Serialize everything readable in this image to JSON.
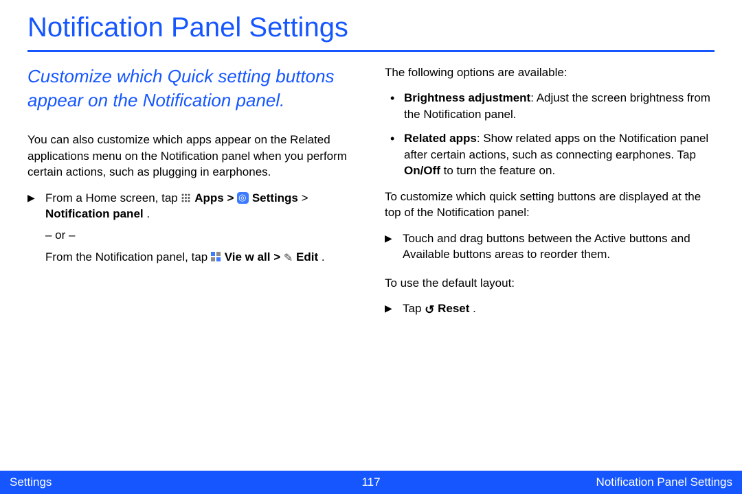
{
  "title": "Notification Panel Settings",
  "lead": "Customize which Quick setting buttons appear on the Notification panel.",
  "left": {
    "intro": "You can also customize which apps appear on the Related applications menu on the Notification panel when you perform certain actions, such as plugging in earphones.",
    "step1_a": "From a Home screen, tap ",
    "apps": "Apps",
    "gt1": " > ",
    "settings": "Settings",
    "gt2": " > ",
    "notif_panel": "Notification panel",
    "dot": ".",
    "or": "– or –",
    "step1_b": "From the Notification panel, tap ",
    "viewall": "Vie w all",
    "gt3": " > ",
    "edit": "Edit",
    "dot2": "."
  },
  "right": {
    "intro": "The following options are available:",
    "b1_label": "Brightness adjustment",
    "b1_body": ": Adjust the screen brightness from the Notification panel.",
    "b2_label": "Related apps",
    "b2_body_a": ": Show related apps on the Notification panel after certain actions, such as connecting earphones. Tap ",
    "onoff": "On/Off",
    "b2_body_b": " to turn the feature on.",
    "para2": "To customize which quick setting buttons are displayed at the top of the Notification panel:",
    "step2": "Touch and drag buttons between the Active buttons and Available buttons areas to reorder them.",
    "para3": "To use the default layout:",
    "step3_a": "Tap ",
    "reset": "Reset",
    "step3_b": "."
  },
  "footer": {
    "left": "Settings",
    "center": "117",
    "right": "Notification Panel Settings"
  }
}
